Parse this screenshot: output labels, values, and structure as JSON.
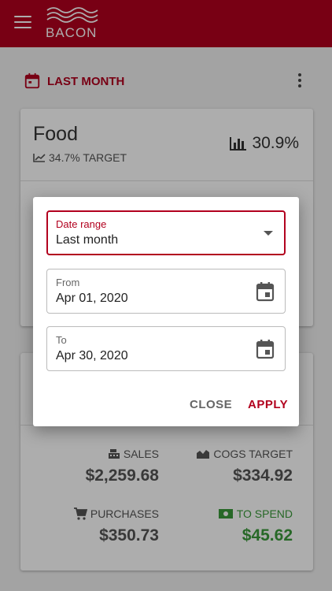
{
  "app": {
    "logo_text": "BACON"
  },
  "period": {
    "label": "LAST MONTH"
  },
  "card1": {
    "title": "Food",
    "target": "34.7% TARGET",
    "percent": "30.9%"
  },
  "card2": {
    "sales_label": "SALES",
    "sales_value": "$2,259.68",
    "cogs_label": "COGS TARGET",
    "cogs_value": "$334.92",
    "purchases_label": "PURCHASES",
    "purchases_value": "$350.73",
    "spend_label": "TO SPEND",
    "spend_value": "$45.62"
  },
  "dialog": {
    "range_label": "Date range",
    "range_value": "Last month",
    "from_label": "From",
    "from_value": "Apr 01, 2020",
    "to_label": "To",
    "to_value": "Apr 30, 2020",
    "close_label": "CLOSE",
    "apply_label": "APPLY"
  },
  "colors": {
    "brand": "#b2001e",
    "positive": "#3a9a3a"
  }
}
